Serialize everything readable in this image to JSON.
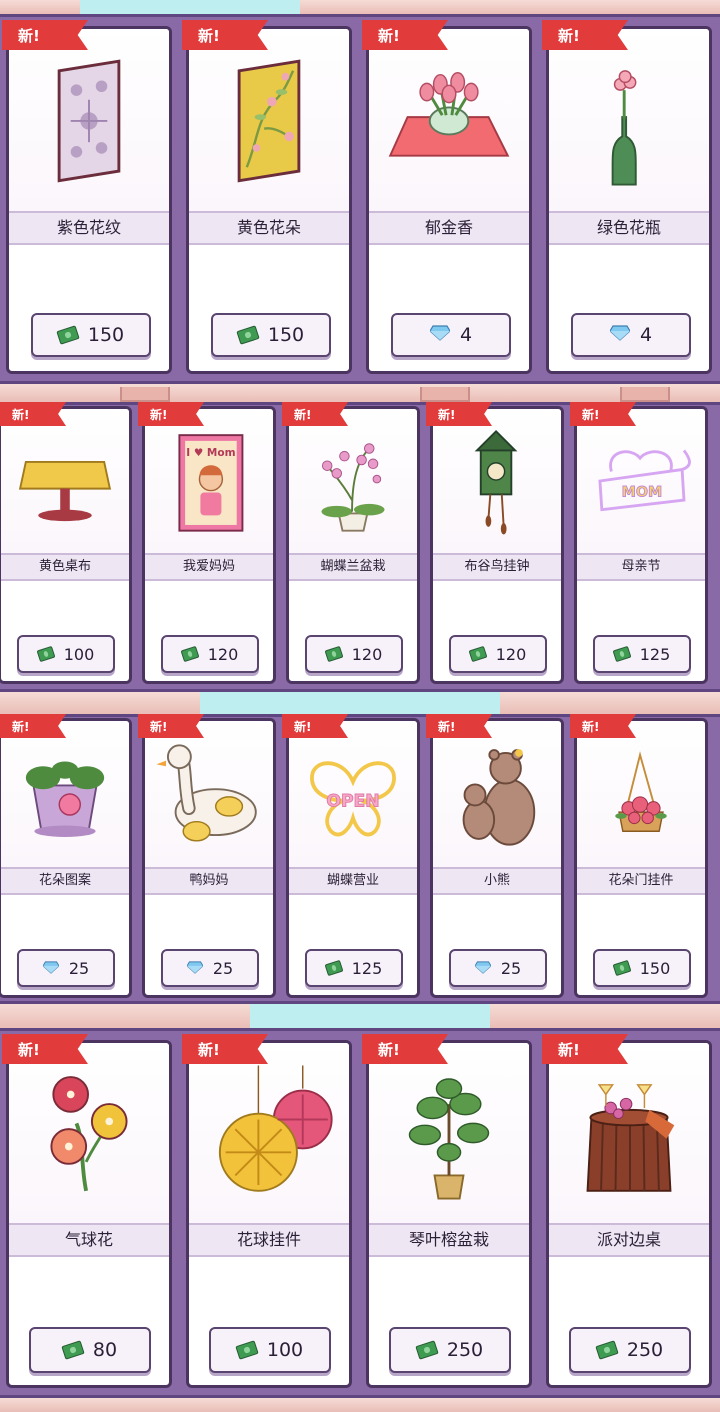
{
  "new_badge": "新!",
  "colors": {
    "shelf": "#8a6aa6",
    "ribbon": "#e23b3b",
    "cash": "#3f9a52",
    "gem": "#7fc8ef"
  },
  "rows": [
    {
      "items": [
        {
          "name": "紫色花纹",
          "price": "150",
          "currency": "cash-icon",
          "icon": "purple-pattern-wallpaper-icon"
        },
        {
          "name": "黄色花朵",
          "price": "150",
          "currency": "cash-icon",
          "icon": "yellow-flower-wallpaper-icon"
        },
        {
          "name": "郁金香",
          "price": "4",
          "currency": "gem-icon",
          "icon": "tulip-vase-icon"
        },
        {
          "name": "绿色花瓶",
          "price": "4",
          "currency": "gem-icon",
          "icon": "green-vase-icon"
        }
      ]
    },
    {
      "items": [
        {
          "name": "黄色桌布",
          "price": "100",
          "currency": "cash-icon",
          "icon": "yellow-tablecloth-icon"
        },
        {
          "name": "我爱妈妈",
          "price": "120",
          "currency": "cash-icon",
          "icon": "i-love-mom-poster-icon",
          "art_text": "I ♥ Mom"
        },
        {
          "name": "蝴蝶兰盆栽",
          "price": "120",
          "currency": "cash-icon",
          "icon": "orchid-pot-icon"
        },
        {
          "name": "布谷鸟挂钟",
          "price": "120",
          "currency": "cash-icon",
          "icon": "cuckoo-clock-icon"
        },
        {
          "name": "母亲节",
          "price": "125",
          "currency": "cash-icon",
          "icon": "mothers-day-neon-icon",
          "art_text": "MOM"
        }
      ]
    },
    {
      "items": [
        {
          "name": "花朵图案",
          "price": "25",
          "currency": "gem-icon",
          "icon": "flower-pattern-pot-icon"
        },
        {
          "name": "鸭妈妈",
          "price": "25",
          "currency": "gem-icon",
          "icon": "mother-duck-icon"
        },
        {
          "name": "蝴蝶营业",
          "price": "125",
          "currency": "cash-icon",
          "icon": "butterfly-open-sign-icon",
          "art_text": "OPEN"
        },
        {
          "name": "小熊",
          "price": "25",
          "currency": "gem-icon",
          "icon": "bear-icon"
        },
        {
          "name": "花朵门挂件",
          "price": "150",
          "currency": "cash-icon",
          "icon": "flower-door-hanger-icon"
        }
      ]
    },
    {
      "items": [
        {
          "name": "气球花",
          "price": "80",
          "currency": "cash-icon",
          "icon": "balloon-flower-icon"
        },
        {
          "name": "花球挂件",
          "price": "100",
          "currency": "cash-icon",
          "icon": "flower-ball-hanger-icon"
        },
        {
          "name": "琴叶榕盆栽",
          "price": "250",
          "currency": "cash-icon",
          "icon": "fiddle-leaf-fig-icon"
        },
        {
          "name": "派对边桌",
          "price": "250",
          "currency": "cash-icon",
          "icon": "party-side-table-icon"
        }
      ]
    }
  ]
}
